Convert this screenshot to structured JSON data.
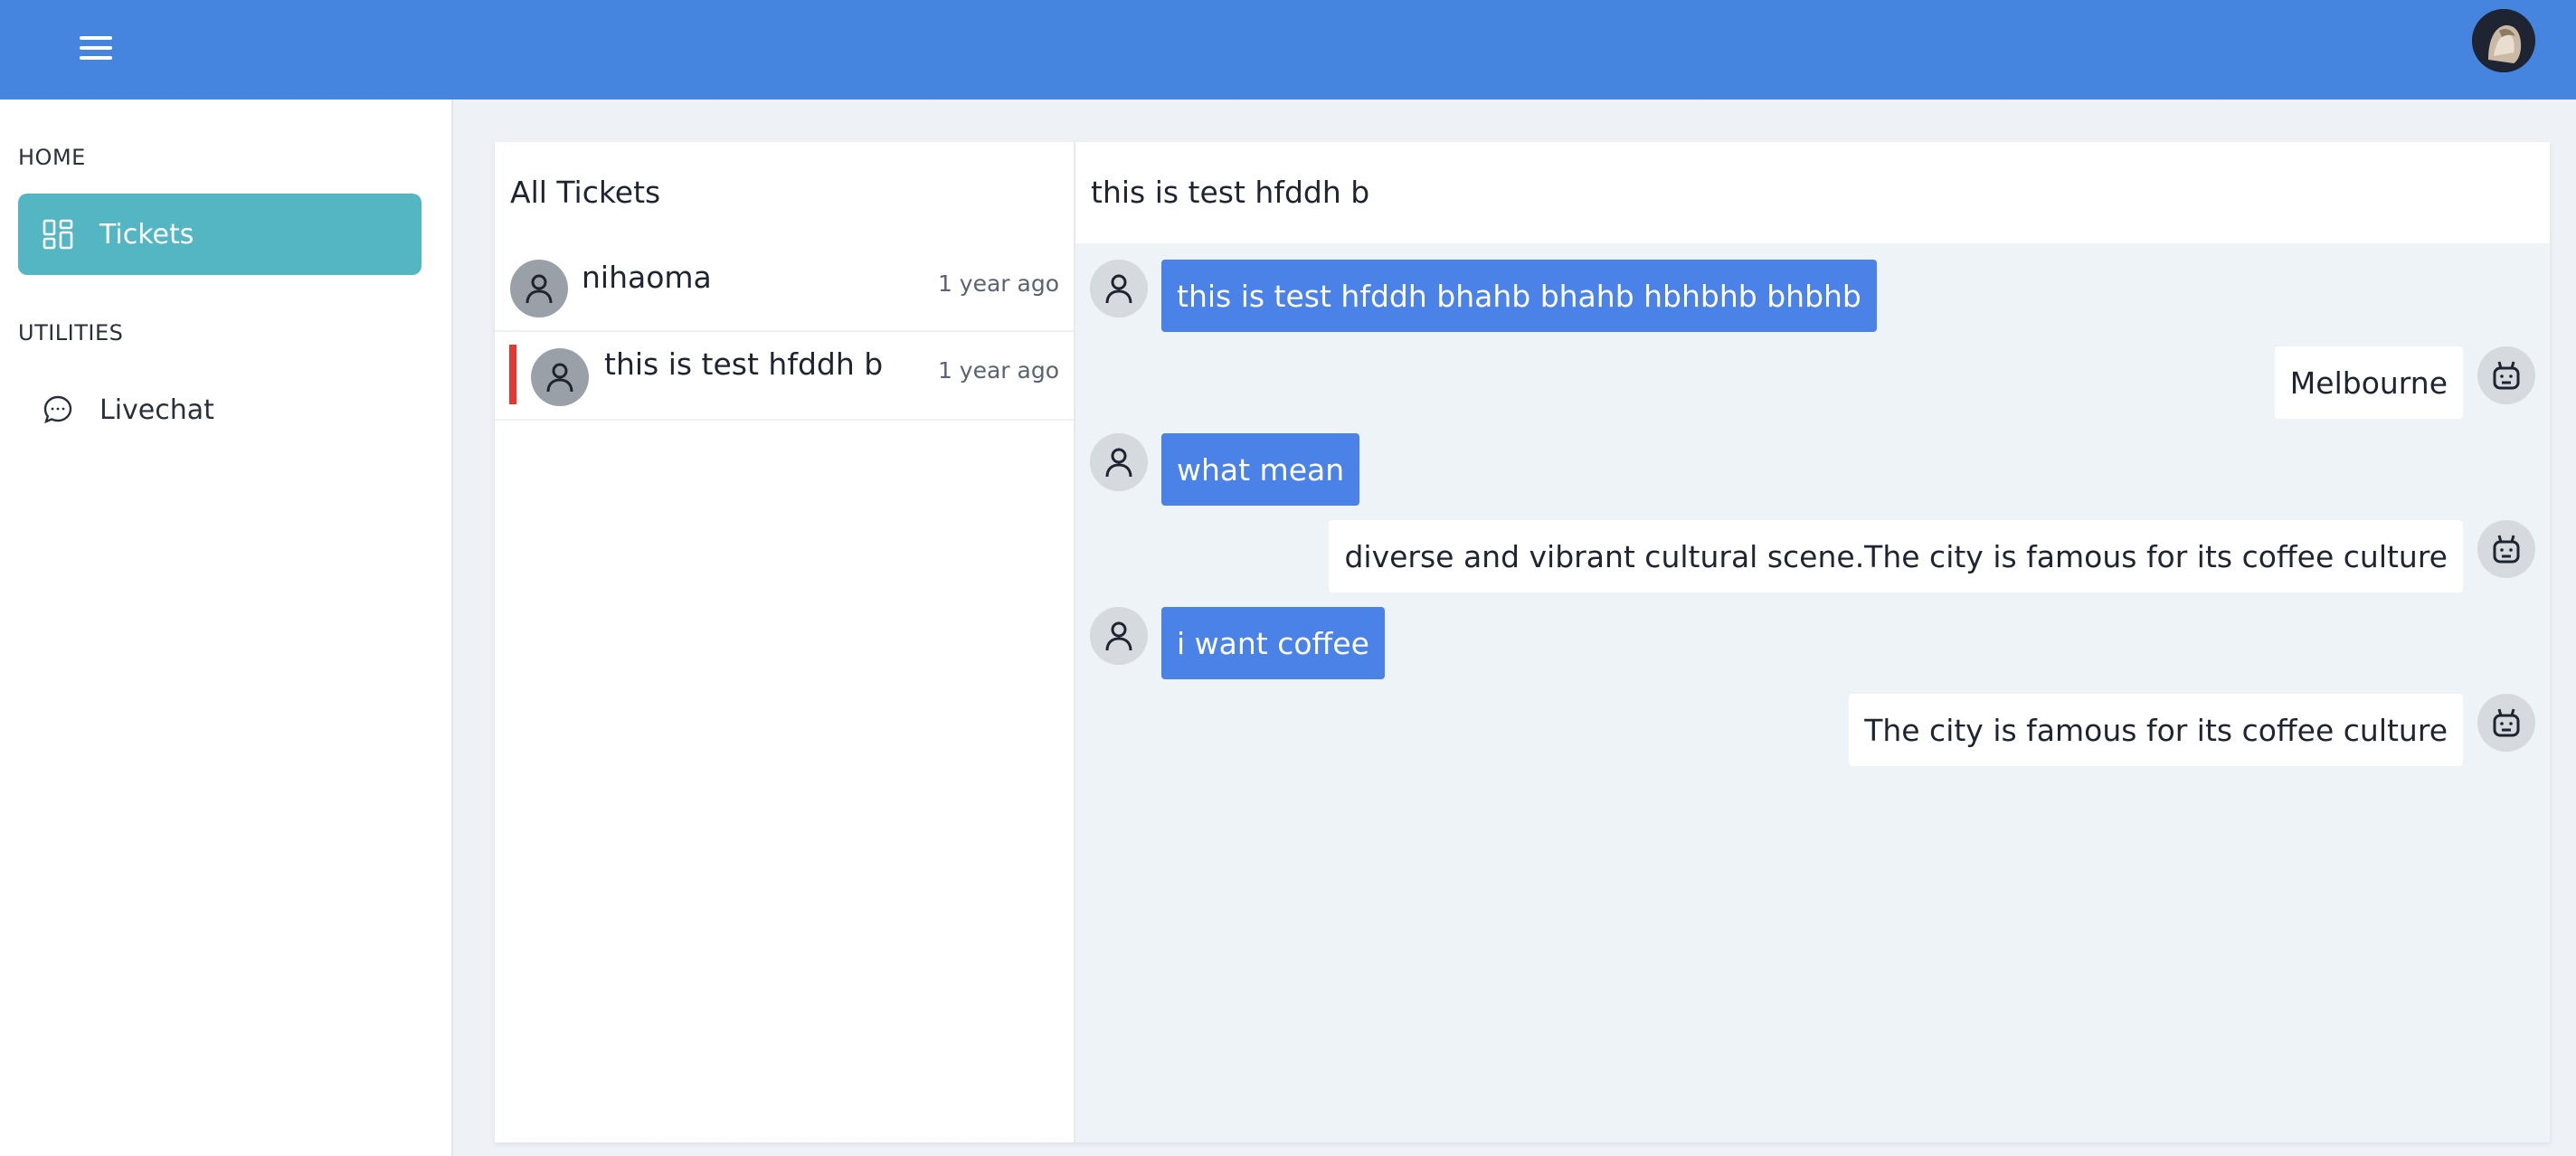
{
  "colors": {
    "header": "#4585df",
    "active_nav": "#54b6c3",
    "user_bubble": "#4b82e8",
    "selected_marker": "#e5372f"
  },
  "header": {
    "menu_icon": "hamburger-menu-icon",
    "avatar_icon": "user-avatar"
  },
  "sidebar": {
    "sections": [
      {
        "label": "HOME",
        "items": [
          {
            "label": "Tickets",
            "icon": "dashboard-grid-icon",
            "active": true
          }
        ]
      },
      {
        "label": "UTILITIES",
        "items": [
          {
            "label": "Livechat",
            "icon": "chat-bubble-icon",
            "active": false
          }
        ]
      }
    ]
  },
  "tickets": {
    "title": "All Tickets",
    "items": [
      {
        "name": "nihaoma",
        "time": "1 year ago",
        "selected": false
      },
      {
        "name": "this is test hfddh b",
        "time": "1 year ago",
        "selected": true
      }
    ]
  },
  "chat": {
    "title": "this is test hfddh b",
    "messages": [
      {
        "sender": "user",
        "text": "this is test hfddh bhahb bhahb hbhbhb bhbhb"
      },
      {
        "sender": "bot",
        "text": "Melbourne"
      },
      {
        "sender": "user",
        "text": "what mean"
      },
      {
        "sender": "bot",
        "text": "diverse and vibrant cultural scene.The city is famous for its coffee culture"
      },
      {
        "sender": "user",
        "text": "i want coffee"
      },
      {
        "sender": "bot",
        "text": "The city is famous for its coffee culture"
      }
    ]
  }
}
